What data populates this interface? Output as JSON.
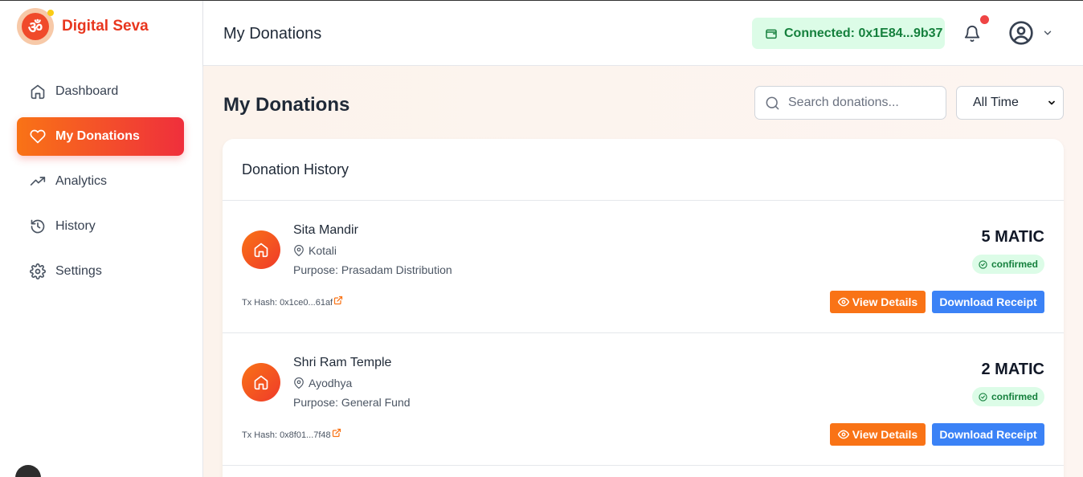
{
  "brand": {
    "name": "Digital Seva",
    "logo_glyph": "ॐ"
  },
  "sidebar": {
    "items": [
      {
        "label": "Dashboard",
        "icon": "home-icon"
      },
      {
        "label": "My Donations",
        "icon": "heart-icon",
        "active": true
      },
      {
        "label": "Analytics",
        "icon": "trending-up-icon"
      },
      {
        "label": "History",
        "icon": "history-icon"
      },
      {
        "label": "Settings",
        "icon": "gear-icon"
      }
    ]
  },
  "header": {
    "title": "My Donations",
    "wallet_status": "Connected: 0x1E84...9b37"
  },
  "main": {
    "title": "My Donations",
    "search_placeholder": "Search donations...",
    "filter_selected": "All Time"
  },
  "history": {
    "title": "Donation History",
    "donations": [
      {
        "temple": "Sita Mandir",
        "location": "Kotali",
        "purpose": "Purpose: Prasadam Distribution",
        "tx_hash": "Tx Hash: 0x1ce0...61af",
        "amount": "5 MATIC",
        "status": "confirmed"
      },
      {
        "temple": "Shri Ram Temple",
        "location": "Ayodhya",
        "purpose": "Purpose: General Fund",
        "tx_hash": "Tx Hash: 0x8f01...7f48",
        "amount": "2 MATIC",
        "status": "confirmed"
      }
    ],
    "view_label": "View Details",
    "download_label": "Download Receipt"
  },
  "colors": {
    "brand": "#e8361e",
    "accent": "#f97316",
    "primary": "#3b82f6",
    "success": "#15803d"
  }
}
